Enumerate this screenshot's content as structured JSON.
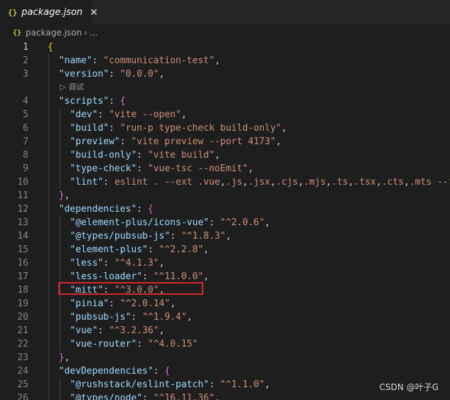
{
  "tab": {
    "icon": "json-braces-icon",
    "glyph": "{}",
    "title": "package.json",
    "close": "✕"
  },
  "breadcrumb": {
    "icon": "json-braces-icon",
    "glyph": "{}",
    "file": "package.json",
    "sep": "›",
    "more": "..."
  },
  "codelens": {
    "icon": "play-icon",
    "glyph": "▷",
    "label": "调试"
  },
  "lines": [
    {
      "n": "1",
      "text": "{"
    },
    {
      "n": "2",
      "text": "  \"name\": \"communication-test\","
    },
    {
      "n": "3",
      "text": "  \"version\": \"0.0.0\","
    },
    {
      "n": "4",
      "text": "  \"scripts\": {"
    },
    {
      "n": "5",
      "text": "    \"dev\": \"vite --open\","
    },
    {
      "n": "6",
      "text": "    \"build\": \"run-p type-check build-only\","
    },
    {
      "n": "7",
      "text": "    \"preview\": \"vite preview --port 4173\","
    },
    {
      "n": "8",
      "text": "    \"build-only\": \"vite build\","
    },
    {
      "n": "9",
      "text": "    \"type-check\": \"vue-tsc --noEmit\","
    },
    {
      "n": "10",
      "text": "    \"lint\": \"eslint . --ext .vue,.js,.jsx,.cjs,.mjs,.ts,.tsx,.cts,.mts --f"
    },
    {
      "n": "11",
      "text": "  },"
    },
    {
      "n": "12",
      "text": "  \"dependencies\": {"
    },
    {
      "n": "13",
      "text": "    \"@element-plus/icons-vue\": \"^2.0.6\","
    },
    {
      "n": "14",
      "text": "    \"@types/pubsub-js\": \"^1.8.3\","
    },
    {
      "n": "15",
      "text": "    \"element-plus\": \"^2.2.8\","
    },
    {
      "n": "16",
      "text": "    \"less\": \"^4.1.3\","
    },
    {
      "n": "17",
      "text": "    \"less-loader\": \"^11.0.0\","
    },
    {
      "n": "18",
      "text": "    \"mitt\": \"^3.0.0\","
    },
    {
      "n": "19",
      "text": "    \"pinia\": \"^2.0.14\","
    },
    {
      "n": "20",
      "text": "    \"pubsub-js\": \"^1.9.4\","
    },
    {
      "n": "21",
      "text": "    \"vue\": \"^3.2.36\","
    },
    {
      "n": "22",
      "text": "    \"vue-router\": \"^4.0.15\""
    },
    {
      "n": "23",
      "text": "  },"
    },
    {
      "n": "24",
      "text": "  \"devDependencies\": {"
    },
    {
      "n": "25",
      "text": "    \"@rushstack/eslint-patch\": \"^1.1.0\","
    },
    {
      "n": "26",
      "text": "    \"@types/node\": \"^16.11.36\","
    }
  ],
  "active_line": "1",
  "highlighted_line": "18",
  "watermark": "CSDN @叶子G",
  "colors": {
    "key": "#9cdcfe",
    "string": "#ce9178",
    "brace_outer": "#ffd700",
    "brace_inner": "#da70d6",
    "highlight_box": "#d9262b"
  }
}
